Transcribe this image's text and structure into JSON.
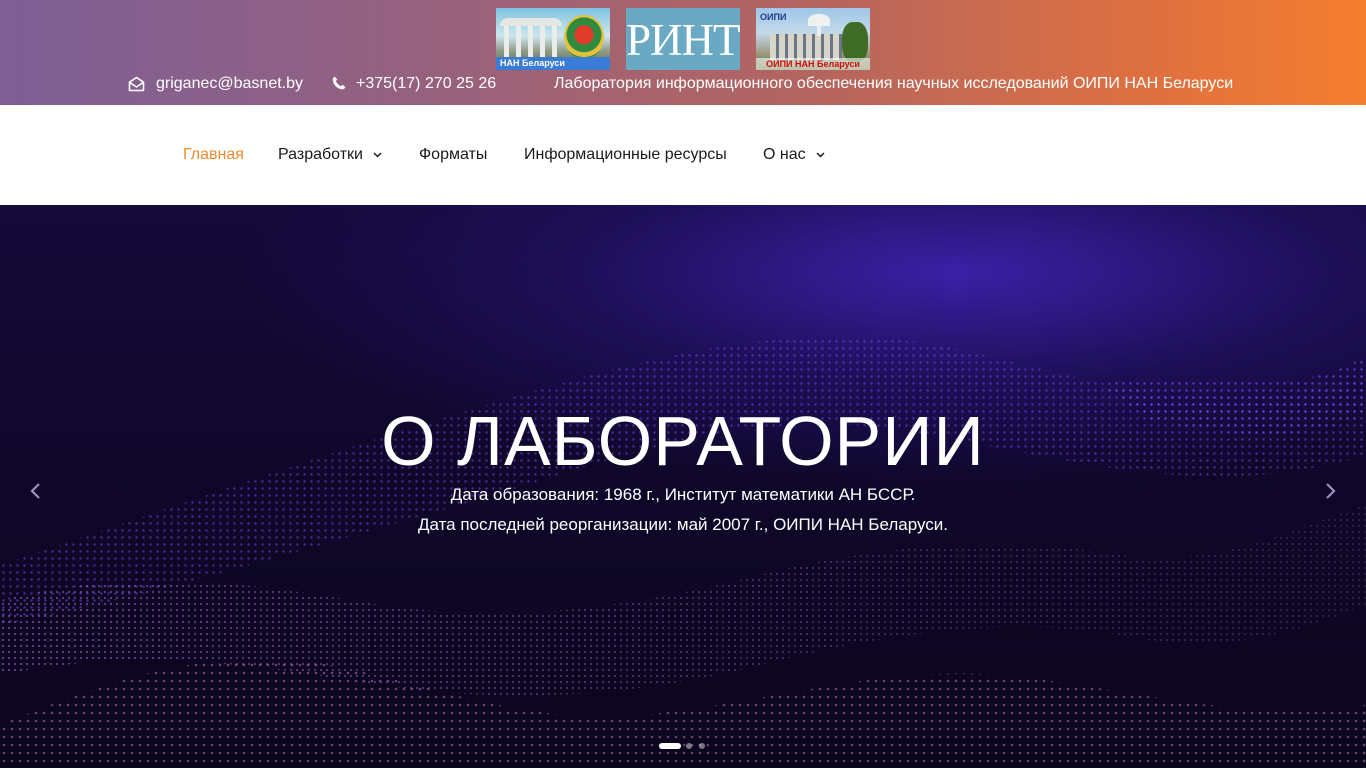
{
  "logos": {
    "nan": {
      "caption": "НАН Беларуси"
    },
    "rinti": {
      "text": "РИНТИ"
    },
    "oipi": {
      "caption": "ОИПИ НАН Беларуси",
      "mini": "ОИПИ"
    }
  },
  "contact": {
    "email": "griganec@basnet.by",
    "phone": "+375(17) 270 25 26",
    "lab_name": "Лаборатория информационного обеспечения научных исследований ОИПИ НАН Беларуси"
  },
  "nav": {
    "items": [
      {
        "label": "Главная",
        "active": true,
        "dropdown": false
      },
      {
        "label": "Разработки",
        "active": false,
        "dropdown": true
      },
      {
        "label": "Форматы",
        "active": false,
        "dropdown": false
      },
      {
        "label": "Информационные ресурсы",
        "active": false,
        "dropdown": false
      },
      {
        "label": "О нас",
        "active": false,
        "dropdown": true
      }
    ]
  },
  "hero": {
    "title": "О ЛАБОРАТОРИИ",
    "line1": "Дата образования: 1968 г., Институт математики АН БССР.",
    "line2": "Дата последней реорганизации: май 2007 г., ОИПИ НАН Беларуси.",
    "slides_total": 3,
    "active_slide": 1
  },
  "icons": {
    "email": "envelope-icon",
    "phone": "phone-icon",
    "prev": "chevron-left-icon",
    "next": "chevron-right-icon",
    "dropdown": "chevron-down-icon"
  },
  "colors": {
    "accent": "#ee8a2c",
    "topbar_start": "#7d5f96",
    "topbar_end": "#f47d2e",
    "hero_bg": "#0d0722"
  }
}
